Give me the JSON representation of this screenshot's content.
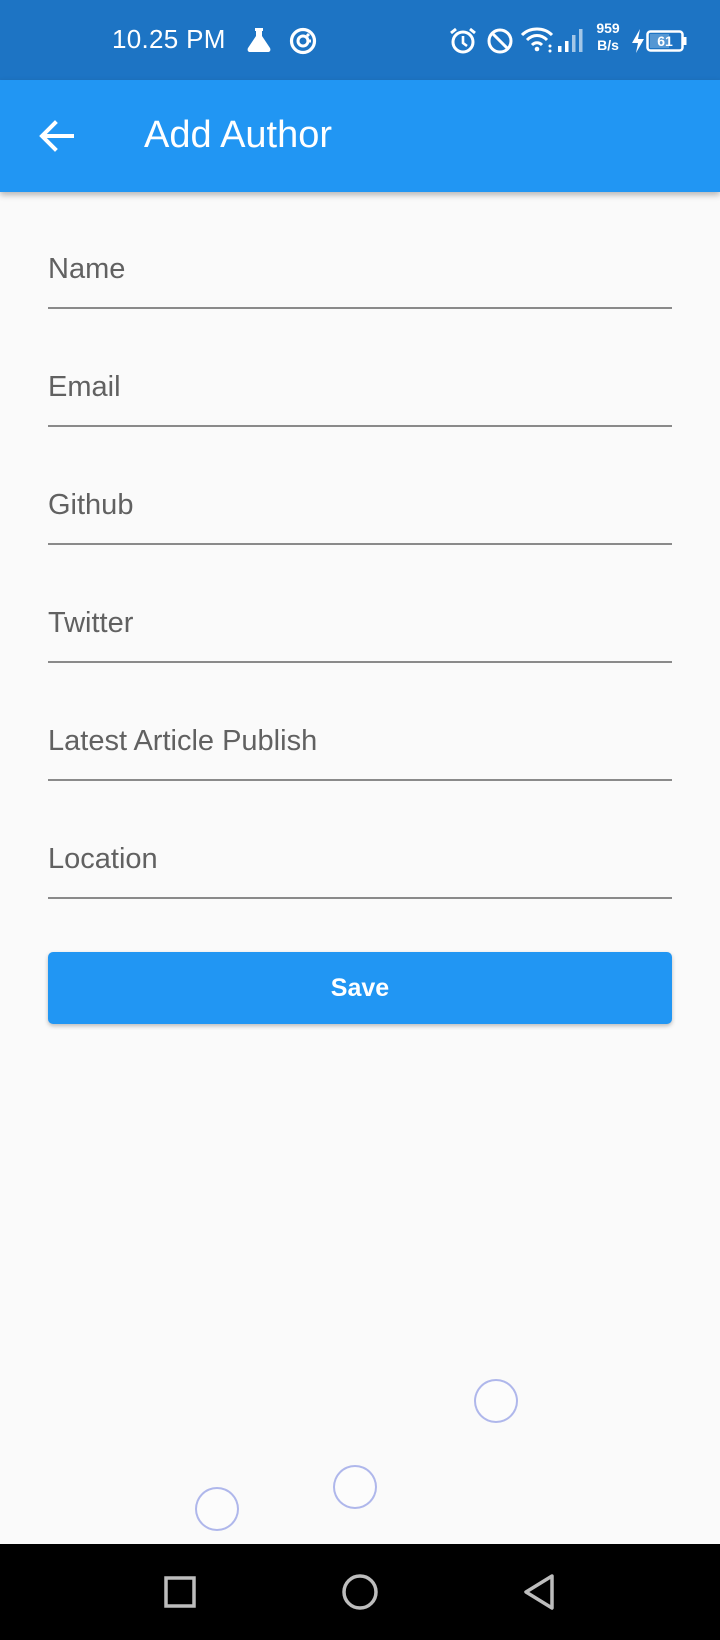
{
  "status_bar": {
    "time": "10.25 PM",
    "net_speed_value": "959",
    "net_speed_unit": "B/s",
    "battery_level": "61",
    "icons": [
      "flask-icon",
      "vpn-icon",
      "alarm-icon",
      "do-not-disturb-icon",
      "wifi-icon",
      "signal-icon",
      "charging-icon",
      "battery-icon"
    ]
  },
  "app_bar": {
    "title": "Add Author",
    "back_icon": "arrow-back-icon"
  },
  "form": {
    "fields": [
      {
        "placeholder": "Name",
        "value": ""
      },
      {
        "placeholder": "Email",
        "value": ""
      },
      {
        "placeholder": "Github",
        "value": ""
      },
      {
        "placeholder": "Twitter",
        "value": ""
      },
      {
        "placeholder": "Latest Article Publish",
        "value": ""
      },
      {
        "placeholder": "Location",
        "value": ""
      }
    ],
    "save_label": "Save"
  },
  "nav_bar": {
    "icons": [
      "recents-square-icon",
      "home-circle-icon",
      "back-triangle-icon"
    ]
  },
  "colors": {
    "status_bar": "#1d74c4",
    "app_bar": "#2196f3",
    "button": "#2196f3",
    "background": "#fafafa"
  }
}
